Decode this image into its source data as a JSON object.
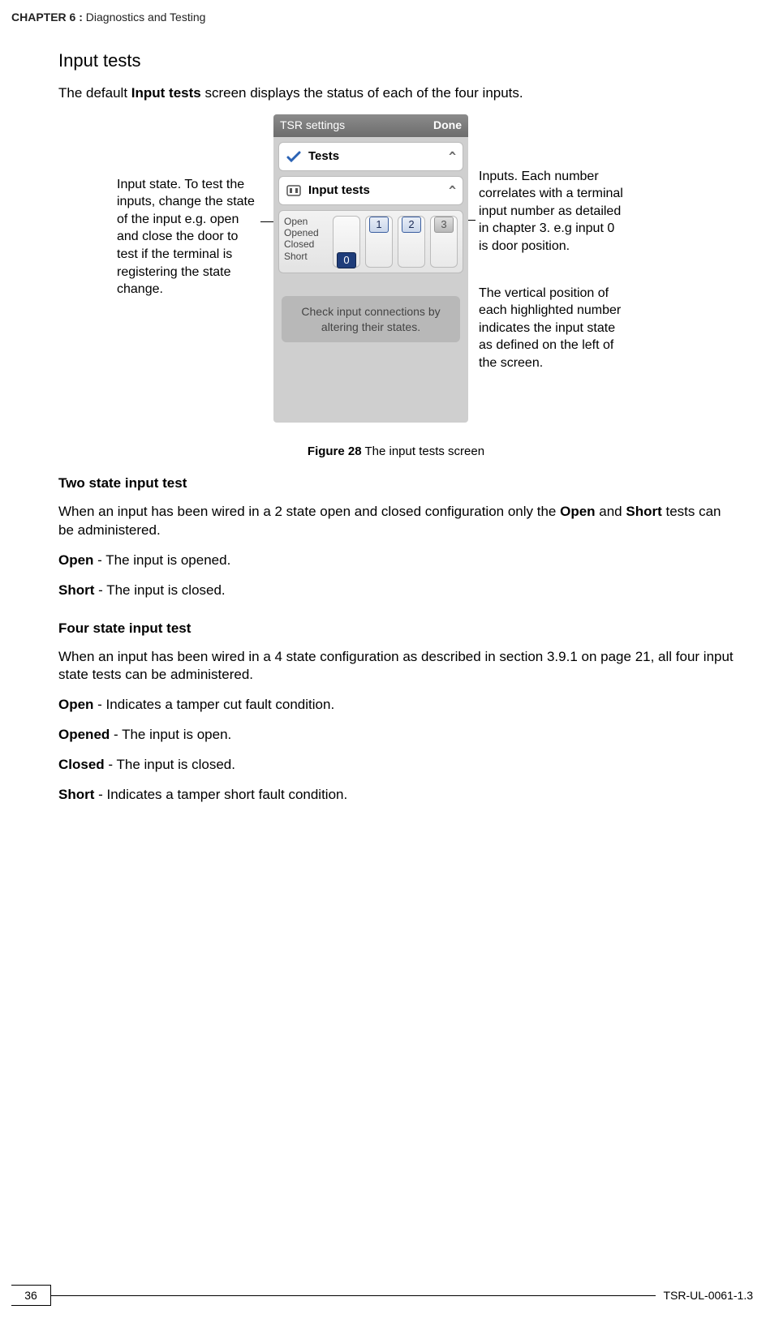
{
  "header": {
    "chapter_label": "CHAPTER 6 :",
    "chapter_title": "Diagnostics and Testing"
  },
  "section_title": "Input tests",
  "intro_pre": "The default ",
  "intro_bold": "Input tests",
  "intro_post": " screen displays the status of each of the four inputs.",
  "figure": {
    "screenshot": {
      "titlebar_left": "TSR settings",
      "titlebar_right": "Done",
      "row_tests_label": "Tests",
      "row_tests_caret": "^",
      "row_input_tests_label": "Input tests",
      "row_input_tests_caret": "^",
      "states": [
        "Open",
        "Opened",
        "Closed",
        "Short"
      ],
      "lanes": [
        {
          "n": "0",
          "pos": "short"
        },
        {
          "n": "1",
          "pos": "open"
        },
        {
          "n": "2",
          "pos": "open"
        },
        {
          "n": "3",
          "pos": "grey"
        }
      ],
      "hint": "Check input connections by altering their states."
    },
    "callout_left": "Input state. To test the inputs, change the state of the input e.g. open and close the door to test if the terminal is registering the state change.",
    "callout_right_a": "Inputs. Each number correlates with a terminal input number as detailed in chapter 3. e.g input 0 is door position.",
    "callout_right_b": "The vertical position of each highlighted number indicates the input state as defined on the left of the screen.",
    "caption_bold": "Figure 28",
    "caption_rest": " The input tests screen"
  },
  "two_state": {
    "heading": "Two state input test",
    "para_pre": "When an input has been wired in a 2 state open and closed configuration only the ",
    "b1": "Open",
    "mid": " and ",
    "b2": "Short",
    "para_post": " tests can be administered.",
    "open_b": "Open",
    "open_t": " - The input is opened.",
    "short_b": "Short",
    "short_t": " - The input is closed."
  },
  "four_state": {
    "heading": "Four state input test",
    "para": "When an input has been wired in a 4 state configuration as described in section 3.9.1 on page 21, all four input state tests can be administered.",
    "open_b": "Open",
    "open_t": " - Indicates a tamper cut fault condition.",
    "opened_b": "Opened",
    "opened_t": " - The input is open.",
    "closed_b": "Closed",
    "closed_t": " - The input is closed.",
    "short_b": "Short",
    "short_t": " - Indicates a tamper short fault condition."
  },
  "footer": {
    "page": "36",
    "doc": "TSR-UL-0061-1.3"
  }
}
